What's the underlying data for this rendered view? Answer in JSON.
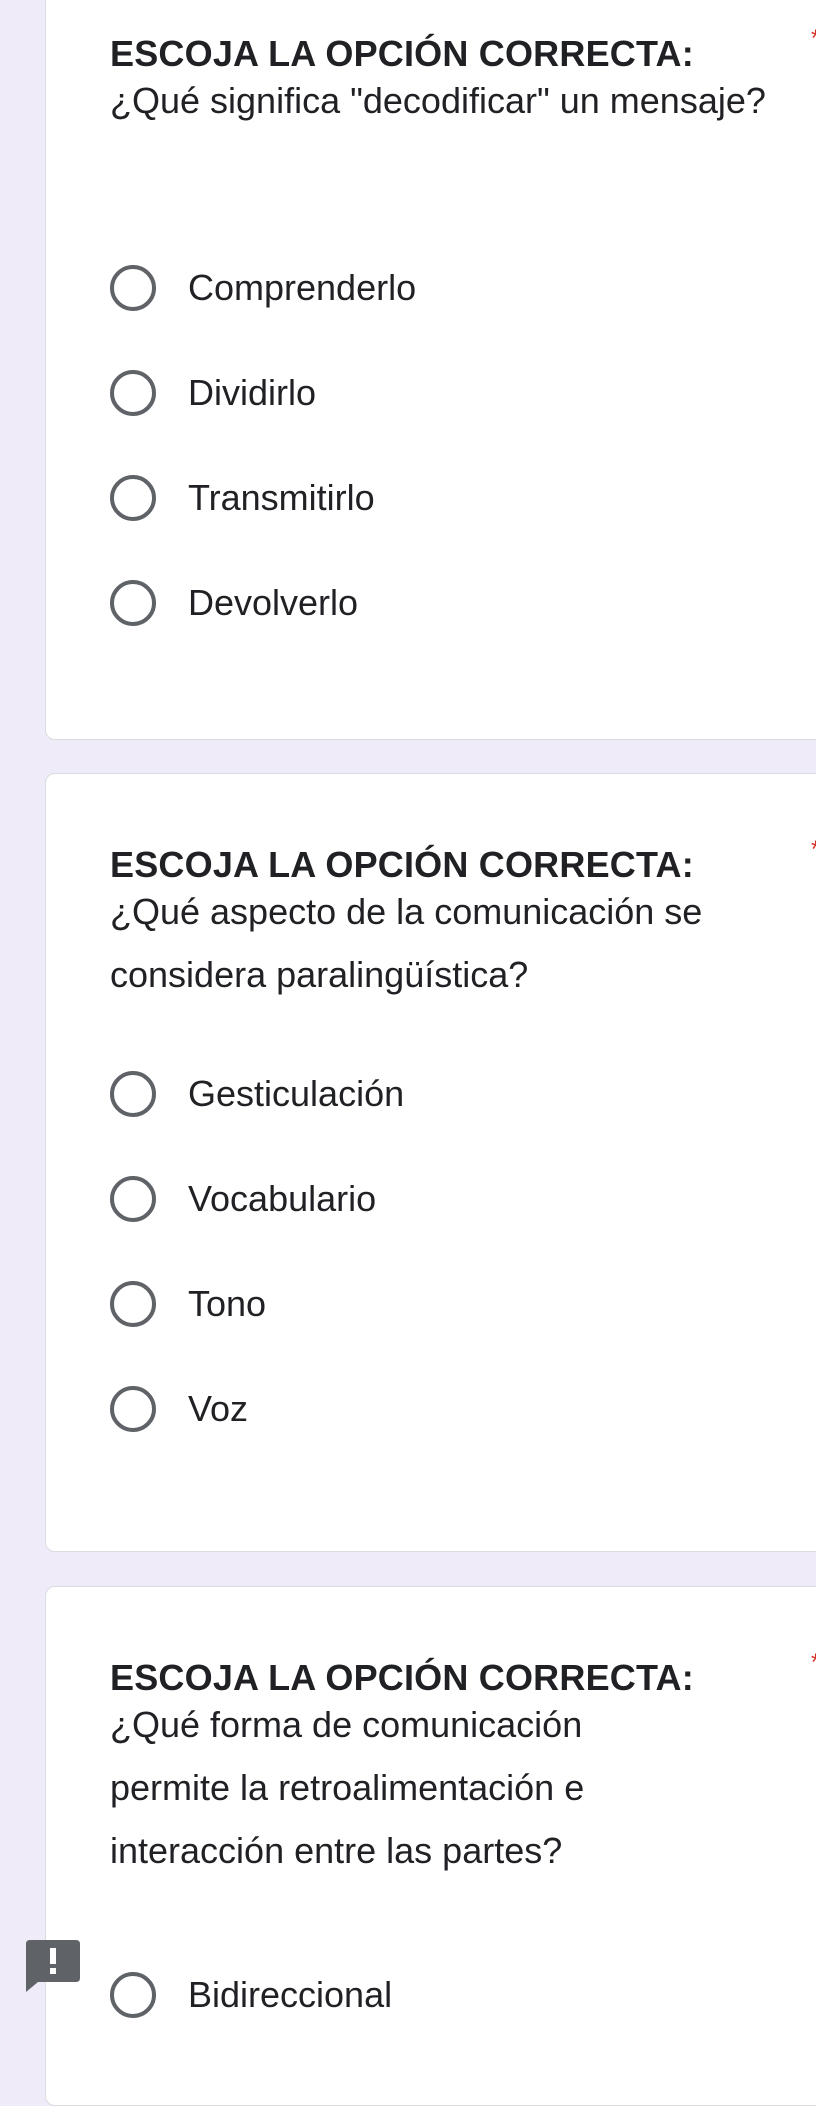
{
  "questions": [
    {
      "heading": "ESCOJA LA OPCIÓN CORRECTA:",
      "required_mark": "*",
      "text": "¿Qué significa \"decodificar\" un mensaje?",
      "options": [
        "Comprenderlo",
        "Dividirlo",
        "Transmitirlo",
        "Devolverlo"
      ]
    },
    {
      "heading": "ESCOJA LA OPCIÓN CORRECTA:",
      "required_mark": "*",
      "text": "¿Qué aspecto de la comunicación se considera paralingüística?",
      "options": [
        "Gesticulación",
        "Vocabulario",
        "Tono",
        "Voz"
      ]
    },
    {
      "heading": "ESCOJA LA OPCIÓN CORRECTA:",
      "required_mark": "*",
      "text": "¿Qué forma de comunicación permite la retroalimentación e interacción entre las partes?",
      "options": [
        "Bidireccional"
      ]
    }
  ],
  "feedback_icon": "report-issue-icon",
  "colors": {
    "background": "#efebf8",
    "card": "#ffffff",
    "required": "#d93025",
    "radio_border": "#5f6368"
  }
}
